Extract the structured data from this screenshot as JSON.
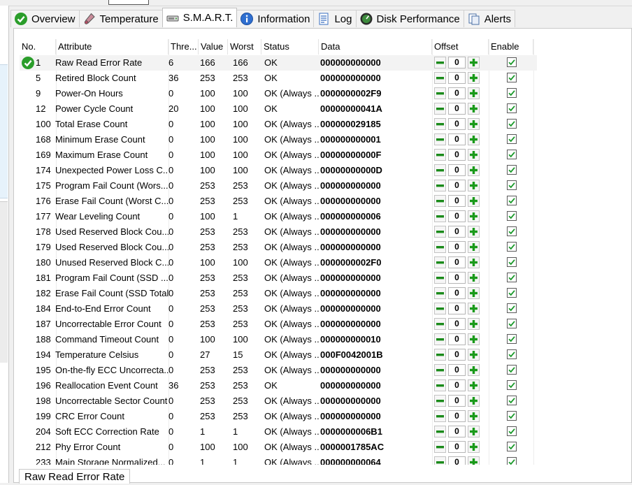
{
  "tabs": [
    {
      "label": "Overview",
      "icon": "ok-check-icon"
    },
    {
      "label": "Temperature",
      "icon": "thermometer-icon"
    },
    {
      "label": "S.M.A.R.T.",
      "icon": "disk-icon"
    },
    {
      "label": "Information",
      "icon": "info-icon"
    },
    {
      "label": "Log",
      "icon": "log-icon"
    },
    {
      "label": "Disk Performance",
      "icon": "gauge-icon"
    },
    {
      "label": "Alerts",
      "icon": "alerts-icon"
    }
  ],
  "active_tab": "S.M.A.R.T.",
  "columns": {
    "no": "No.",
    "attribute": "Attribute",
    "threshold": "Thre...",
    "value": "Value",
    "worst": "Worst",
    "status": "Status",
    "data": "Data",
    "offset": "Offset",
    "enable": "Enable"
  },
  "colors": {
    "minus": "#1a8a1a",
    "plus": "#1a9a1a",
    "check": "#1b9a2b",
    "ok_icon": "#2a9d2a"
  },
  "rows": [
    {
      "no": "1",
      "attr": "Raw Read Error Rate",
      "thr": "6",
      "val": "166",
      "worst": "166",
      "status": "OK",
      "data": "000000000000",
      "offset": "0",
      "ok_icon": true
    },
    {
      "no": "5",
      "attr": "Retired Block Count",
      "thr": "36",
      "val": "253",
      "worst": "253",
      "status": "OK",
      "data": "000000000000",
      "offset": "0"
    },
    {
      "no": "9",
      "attr": "Power-On Hours",
      "thr": "0",
      "val": "100",
      "worst": "100",
      "status": "OK (Always ...",
      "data": "0000000002F9",
      "offset": "0"
    },
    {
      "no": "12",
      "attr": "Power Cycle Count",
      "thr": "20",
      "val": "100",
      "worst": "100",
      "status": "OK",
      "data": "00000000041A",
      "offset": "0"
    },
    {
      "no": "100",
      "attr": "Total Erase Count",
      "thr": "0",
      "val": "100",
      "worst": "100",
      "status": "OK (Always ...",
      "data": "000000029185",
      "offset": "0"
    },
    {
      "no": "168",
      "attr": "Minimum Erase Count",
      "thr": "0",
      "val": "100",
      "worst": "100",
      "status": "OK (Always ...",
      "data": "000000000001",
      "offset": "0"
    },
    {
      "no": "169",
      "attr": "Maximum Erase Count",
      "thr": "0",
      "val": "100",
      "worst": "100",
      "status": "OK (Always ...",
      "data": "00000000000F",
      "offset": "0"
    },
    {
      "no": "174",
      "attr": "Unexpected Power Loss C...",
      "thr": "0",
      "val": "100",
      "worst": "100",
      "status": "OK (Always ...",
      "data": "00000000000D",
      "offset": "0"
    },
    {
      "no": "175",
      "attr": "Program Fail Count (Wors...",
      "thr": "0",
      "val": "253",
      "worst": "253",
      "status": "OK (Always ...",
      "data": "000000000000",
      "offset": "0"
    },
    {
      "no": "176",
      "attr": "Erase Fail Count (Worst C...",
      "thr": "0",
      "val": "253",
      "worst": "253",
      "status": "OK (Always ...",
      "data": "000000000000",
      "offset": "0"
    },
    {
      "no": "177",
      "attr": "Wear Leveling Count",
      "thr": "0",
      "val": "100",
      "worst": "1",
      "status": "OK (Always ...",
      "data": "000000000006",
      "offset": "0"
    },
    {
      "no": "178",
      "attr": "Used Reserved Block Cou...",
      "thr": "0",
      "val": "253",
      "worst": "253",
      "status": "OK (Always ...",
      "data": "000000000000",
      "offset": "0"
    },
    {
      "no": "179",
      "attr": "Used Reserved Block Cou...",
      "thr": "0",
      "val": "253",
      "worst": "253",
      "status": "OK (Always ...",
      "data": "000000000000",
      "offset": "0"
    },
    {
      "no": "180",
      "attr": "Unused Reserved Block C...",
      "thr": "0",
      "val": "100",
      "worst": "100",
      "status": "OK (Always ...",
      "data": "0000000002F0",
      "offset": "0"
    },
    {
      "no": "181",
      "attr": "Program Fail Count (SSD ...",
      "thr": "0",
      "val": "253",
      "worst": "253",
      "status": "OK (Always ...",
      "data": "000000000000",
      "offset": "0"
    },
    {
      "no": "182",
      "attr": "Erase Fail Count (SSD Total)",
      "thr": "0",
      "val": "253",
      "worst": "253",
      "status": "OK (Always ...",
      "data": "000000000000",
      "offset": "0"
    },
    {
      "no": "184",
      "attr": "End-to-End Error Count",
      "thr": "0",
      "val": "253",
      "worst": "253",
      "status": "OK (Always ...",
      "data": "000000000000",
      "offset": "0"
    },
    {
      "no": "187",
      "attr": "Uncorrectable Error Count",
      "thr": "0",
      "val": "253",
      "worst": "253",
      "status": "OK (Always ...",
      "data": "000000000000",
      "offset": "0"
    },
    {
      "no": "188",
      "attr": "Command Timeout Count",
      "thr": "0",
      "val": "100",
      "worst": "100",
      "status": "OK (Always ...",
      "data": "000000000010",
      "offset": "0"
    },
    {
      "no": "194",
      "attr": "Temperature Celsius",
      "thr": "0",
      "val": "27",
      "worst": "15",
      "status": "OK (Always ...",
      "data": "000F0042001B",
      "offset": "0"
    },
    {
      "no": "195",
      "attr": "On-the-fly ECC Uncorrecta...",
      "thr": "0",
      "val": "253",
      "worst": "253",
      "status": "OK (Always ...",
      "data": "000000000000",
      "offset": "0"
    },
    {
      "no": "196",
      "attr": "Reallocation Event Count",
      "thr": "36",
      "val": "253",
      "worst": "253",
      "status": "OK",
      "data": "000000000000",
      "offset": "0"
    },
    {
      "no": "198",
      "attr": "Uncorrectable Sector Count",
      "thr": "0",
      "val": "253",
      "worst": "253",
      "status": "OK (Always ...",
      "data": "000000000000",
      "offset": "0"
    },
    {
      "no": "199",
      "attr": "CRC Error Count",
      "thr": "0",
      "val": "253",
      "worst": "253",
      "status": "OK (Always ...",
      "data": "000000000000",
      "offset": "0"
    },
    {
      "no": "204",
      "attr": "Soft ECC Correction Rate",
      "thr": "0",
      "val": "1",
      "worst": "1",
      "status": "OK (Always ...",
      "data": "0000000006B1",
      "offset": "0"
    },
    {
      "no": "212",
      "attr": "Phy Error Count",
      "thr": "0",
      "val": "100",
      "worst": "100",
      "status": "OK (Always ...",
      "data": "0000001785AC",
      "offset": "0"
    },
    {
      "no": "233",
      "attr": "Main Storage Normalized...",
      "thr": "0",
      "val": "1",
      "worst": "1",
      "status": "OK (Always ...",
      "data": "000000000064",
      "offset": "0"
    }
  ],
  "statusbar": {
    "text": "Raw Read Error Rate"
  }
}
